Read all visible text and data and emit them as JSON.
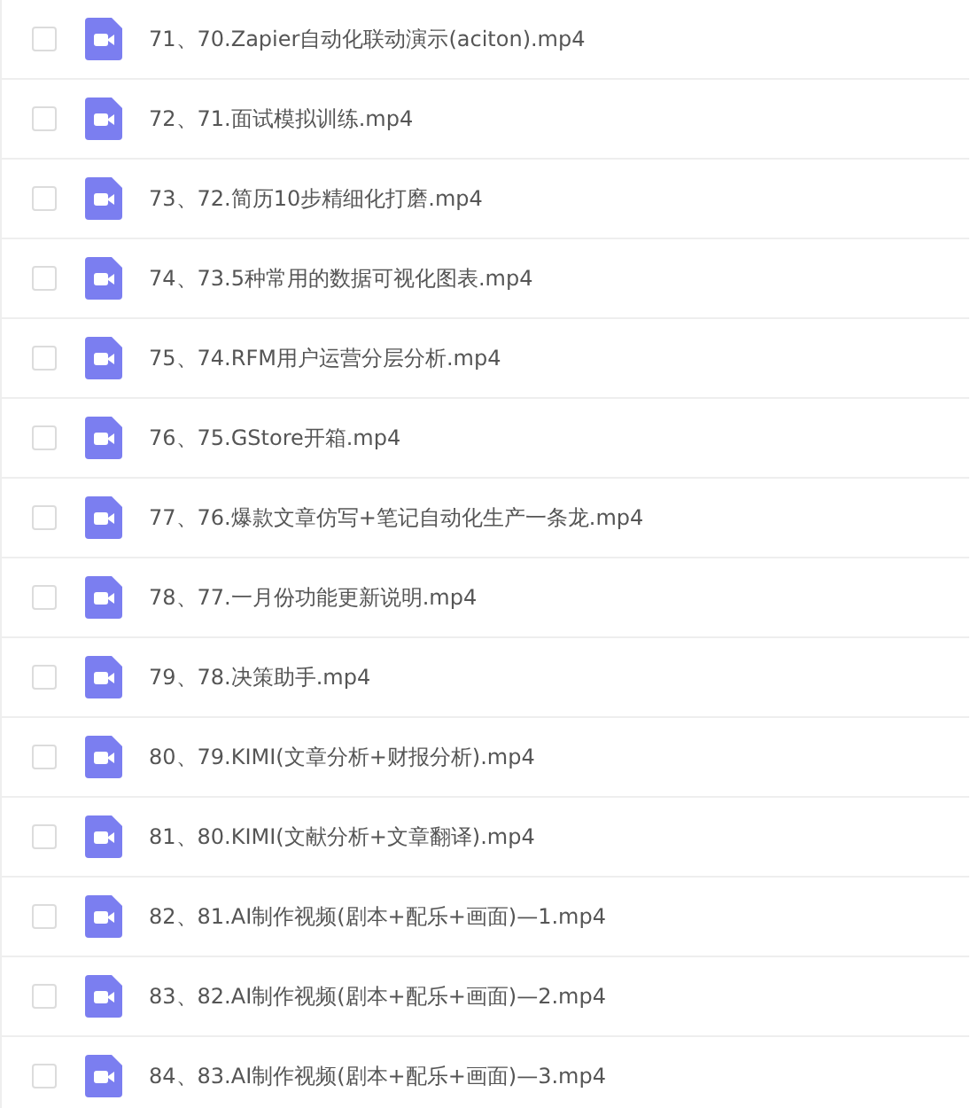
{
  "files": [
    {
      "name": "71、70.Zapier自动化联动演示(aciton).mp4",
      "checked": false
    },
    {
      "name": "72、71.面试模拟训练.mp4",
      "checked": false
    },
    {
      "name": "73、72.简历10步精细化打磨.mp4",
      "checked": false
    },
    {
      "name": "74、73.5种常用的数据可视化图表.mp4",
      "checked": false
    },
    {
      "name": "75、74.RFM用户运营分层分析.mp4",
      "checked": false
    },
    {
      "name": "76、75.GStore开箱.mp4",
      "checked": false
    },
    {
      "name": "77、76.爆款文章仿写+笔记自动化生产一条龙.mp4",
      "checked": false
    },
    {
      "name": "78、77.一月份功能更新说明.mp4",
      "checked": false
    },
    {
      "name": "79、78.决策助手.mp4",
      "checked": false
    },
    {
      "name": "80、79.KIMI(文章分析+财报分析).mp4",
      "checked": false
    },
    {
      "name": "81、80.KIMI(文献分析+文章翻译).mp4",
      "checked": false
    },
    {
      "name": "82、81.AI制作视频(剧本+配乐+画面)—1.mp4",
      "checked": false
    },
    {
      "name": "83、82.AI制作视频(剧本+配乐+画面)—2.mp4",
      "checked": false
    },
    {
      "name": "84、83.AI制作视频(剧本+配乐+画面)—3.mp4",
      "checked": false
    }
  ]
}
